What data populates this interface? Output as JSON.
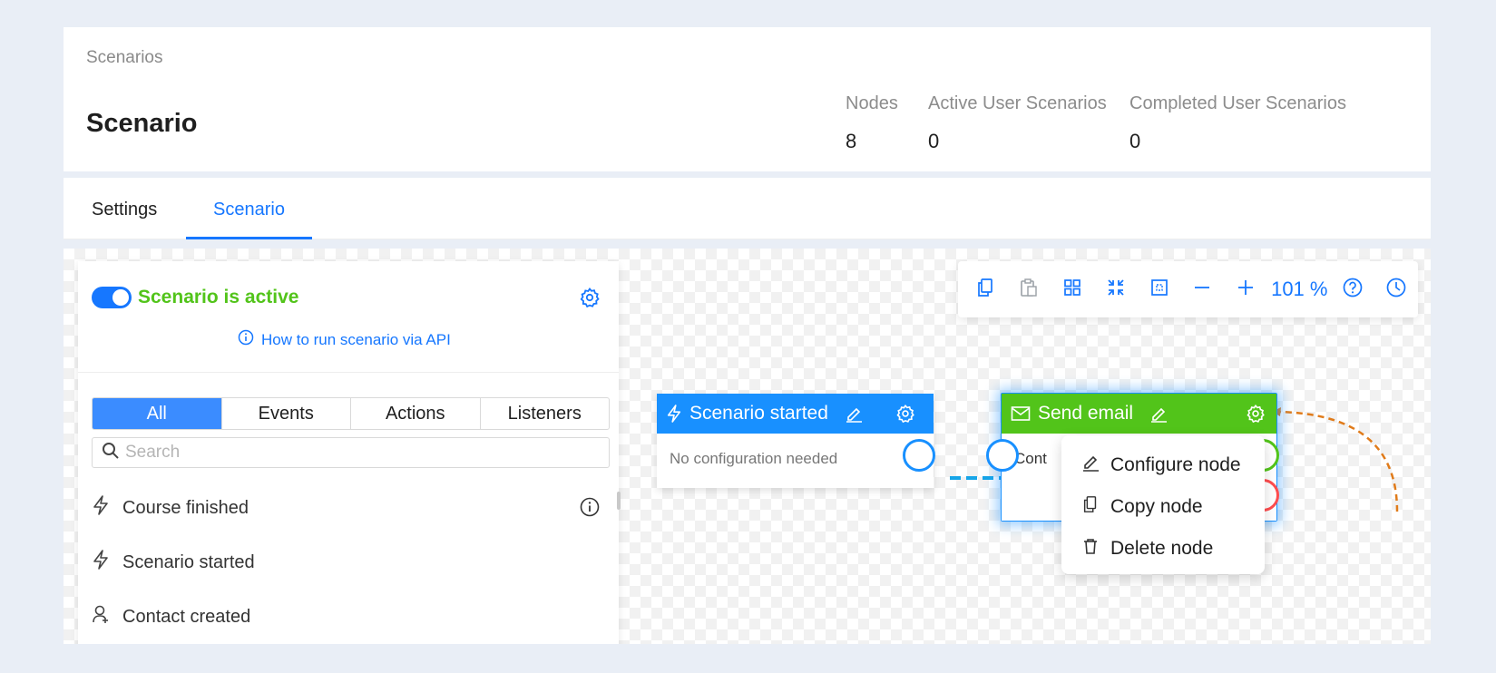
{
  "header": {
    "breadcrumb": "Scenarios",
    "title": "Scenario",
    "stats": [
      {
        "label": "Nodes",
        "value": "8"
      },
      {
        "label": "Active User Scenarios",
        "value": "0"
      },
      {
        "label": "Completed User Scenarios",
        "value": "0"
      }
    ]
  },
  "tabs": [
    {
      "label": "Settings",
      "active": false
    },
    {
      "label": "Scenario",
      "active": true
    }
  ],
  "panel": {
    "status_label": "Scenario is active",
    "active": true,
    "api_link": "How to run scenario via API",
    "filters": [
      "All",
      "Events",
      "Actions",
      "Listeners"
    ],
    "selected_filter": "All",
    "search_placeholder": "Search",
    "items": [
      {
        "label": "Course finished",
        "icon": "lightning-icon"
      },
      {
        "label": "Scenario started",
        "icon": "lightning-icon"
      },
      {
        "label": "Contact created",
        "icon": "user-add-icon"
      }
    ]
  },
  "toolbar": {
    "zoom": "101 %"
  },
  "nodes": [
    {
      "title": "Scenario started",
      "body": "No configuration needed",
      "color": "#1890ff"
    },
    {
      "title": "Send email",
      "body": "Cont",
      "color": "#52c41a"
    }
  ],
  "context_menu": {
    "items": [
      "Configure node",
      "Copy node",
      "Delete node"
    ]
  },
  "colors": {
    "accent": "#1677ff",
    "success": "#52c41a",
    "danger": "#ff4d4f",
    "connector": "#e07b1a"
  }
}
